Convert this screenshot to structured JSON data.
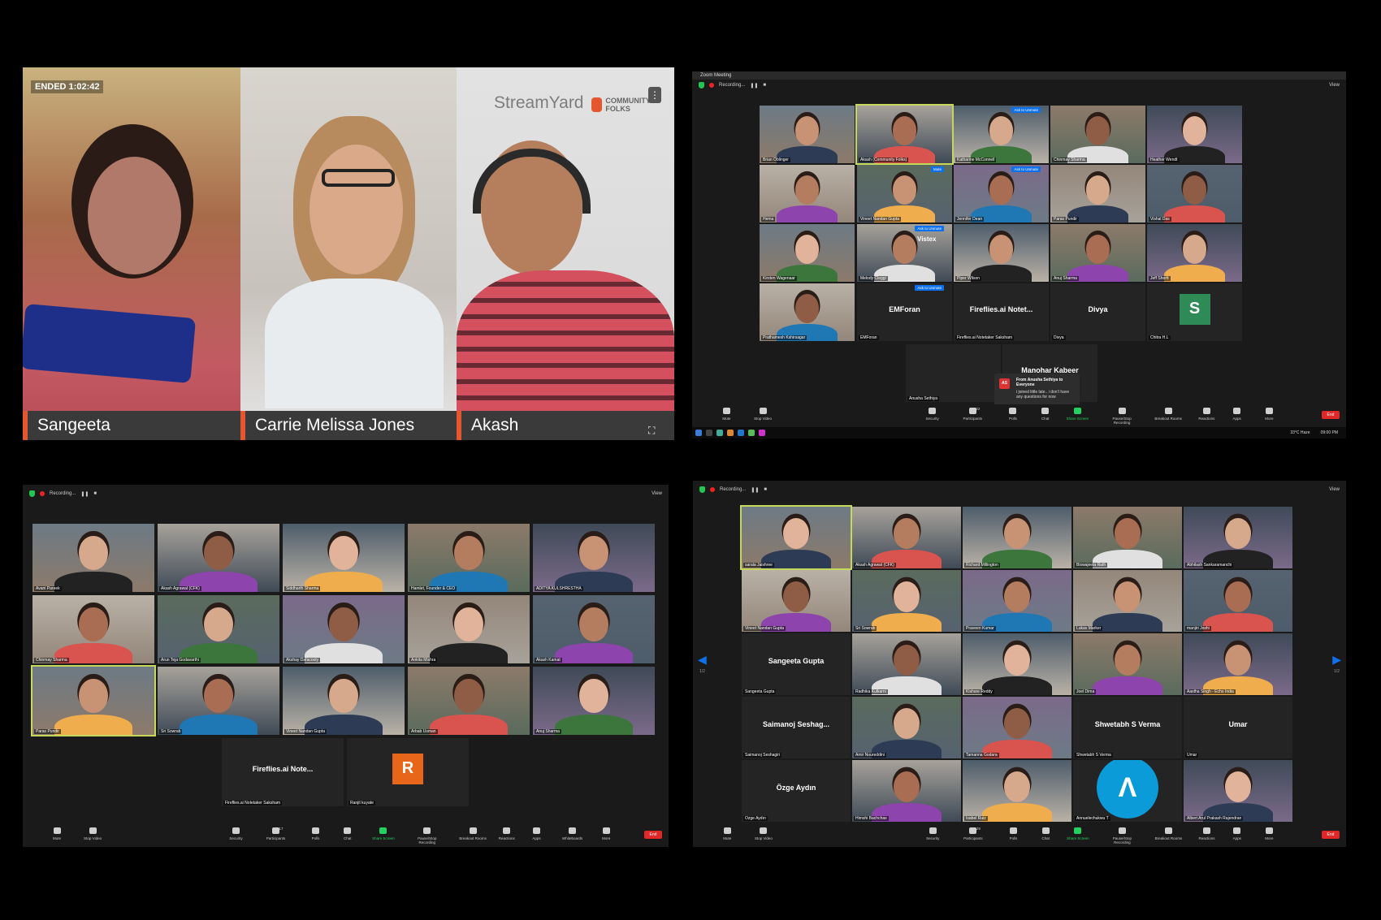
{
  "streamyard": {
    "ended_label": "ENDED 1:02:42",
    "brand": "StreamYard",
    "community_brand": "COMMUNITY FOLKS",
    "menu_icon": "vertical-dots-icon",
    "fullscreen_icon": "fullscreen-icon",
    "speakers": [
      "Sangeeta",
      "Carrie Melissa Jones",
      "Akash"
    ]
  },
  "zoom_meeting": {
    "window_title": "Zoom Meeting",
    "recording_label": "Recording...",
    "view_label": "View",
    "tiles": [
      "Brian Oblinger",
      "Akash (Community Folks)",
      "Katharine McConnell",
      "Chinmay Sharma",
      "Heather Wendt",
      "Hema",
      "Vineet Nandan Gupta",
      "Jennifer Dean",
      "Paras Pundir",
      "Vishal Das",
      "Kirsten Wagenaar",
      "Melody Cleggl",
      "Piper Wilson",
      "Anuj Sharma",
      "Jeff Shortt",
      "Prathamesh Kshirsagar",
      "EMForan",
      "Fireflies.ai Notetaker Saksham",
      "Divya",
      "Chitra H.L",
      "Anusha Sethiya",
      "Manohar Kabeer"
    ],
    "big_names": [
      "EMForan",
      "Fireflies.ai  Notet...",
      "Divya",
      "Manohar Kabeer"
    ],
    "avatar_letter": "S",
    "vistex": "Vistex",
    "ask_to_unmute": "Ask to Unmute",
    "mute_label": "Mute",
    "chat_popup": {
      "avatar": "AS",
      "from": "From Anusha Sethiya to Everyone",
      "message": "i joined little late.. i don't have any questions for now"
    },
    "toolbar": [
      "Mute",
      "Stop Video",
      "Security",
      "Participants",
      "Polls",
      "Chat",
      "Share Screen",
      "Pause/Stop Recording",
      "Breakout Rooms",
      "Reactions",
      "Apps",
      "More"
    ],
    "participants_count": "22",
    "end_label": "End",
    "taskbar": {
      "weather": "33°C  Haze",
      "time": "09:00 PM"
    }
  },
  "zoom_bottom_left": {
    "recording_label": "Recording...",
    "view_label": "View",
    "tiles": [
      "Avani Pareek",
      "Akash Agrawal (CFK)",
      "Siddharth Sharma",
      "Hamlet, Founder & CEO",
      "ADITYA KULSHRESTHA",
      "Chinmay Sharma",
      "Arun Teja Godavarthi",
      "Akshay Dafacooly",
      "Ankita Mishra",
      "Akash Kamat",
      "Paras Pundir",
      "Sri Sowrab",
      "Vineet Nandan Gupta",
      "Arbab Usman",
      "Anuj Sharma",
      "Fireflies.ai Notetaker Saksham",
      "Ranjit kuyate"
    ],
    "big_name": "Fireflies.ai  Note...",
    "avatar_letter": "R",
    "toolbar": [
      "Mute",
      "Stop Video",
      "Security",
      "Participants",
      "Polls",
      "Chat",
      "Share Screen",
      "Pause/Stop Recording",
      "Breakout Rooms",
      "Reactions",
      "Apps",
      "Whiteboards",
      "More"
    ],
    "participants_count": "17",
    "end_label": "End"
  },
  "zoom_bottom_right": {
    "recording_label": "Recording...",
    "view_label": "View",
    "tiles": [
      "sarala Jaishree",
      "Akash Agrawal (CFK)",
      "Richard Millington",
      "Biswajeeta Rath",
      "Abhilash Sankaramanchi",
      "Vineet Nandan Gupta",
      "Sri Sowrab",
      "Praveen Kumar",
      "Lukas Marker",
      "manjiri Joshi",
      "Sangeeta Gupta",
      "Radhika Kulkarni",
      "Kishore Reddy",
      "Joel Dima",
      "Aastha Singh - Echo India",
      "Saimanoj Seshagiri",
      "Amir Noureddini",
      "Tamanna Godara",
      "Shwetabh S Verma",
      "Umar",
      "Özge Aydın",
      "Himshi Bachchas",
      "Isabel Ruiz",
      "Annuelechukwu T",
      "Albert Arul Prakash Rajendran"
    ],
    "big_names": [
      "Sangeeta Gupta",
      "Saimanoj  Seshag...",
      "Shwetabh S Verma",
      "Umar",
      "Özge Aydın"
    ],
    "page_left": "1/2",
    "page_right": "1/2",
    "toolbar": [
      "Mute",
      "Stop Video",
      "Security",
      "Participants",
      "Polls",
      "Chat",
      "Share Screen",
      "Pause/Stop Recording",
      "Breakout Rooms",
      "Reactions",
      "Apps",
      "More"
    ],
    "participants_count": "29",
    "end_label": "End"
  }
}
